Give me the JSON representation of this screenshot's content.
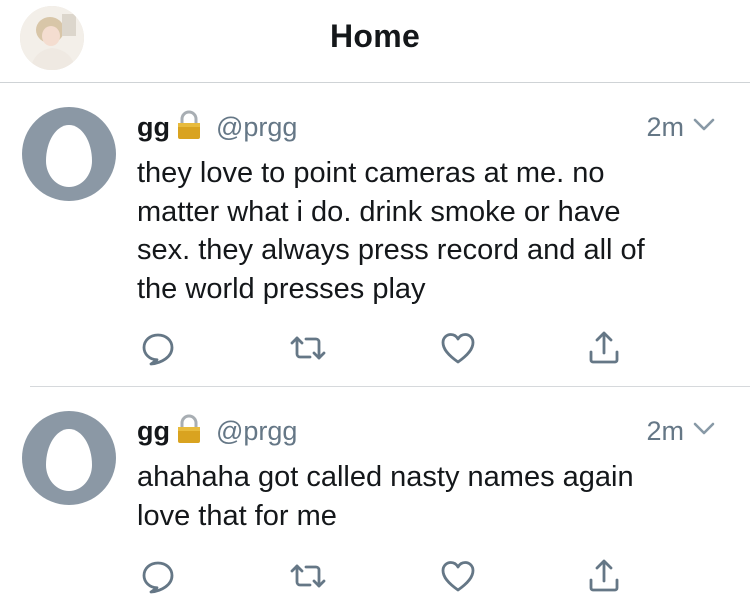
{
  "header": {
    "title": "Home"
  },
  "tweets": [
    {
      "name": "gg",
      "handle": "@prgg",
      "time": "2m",
      "text": "they love to point cameras at me. no\nmatter what i do. drink smoke or have\nsex. they always press record and all of\nthe world presses play"
    },
    {
      "name": "gg",
      "handle": "@prgg",
      "time": "2m",
      "text": "ahahaha got called nasty names again\nlove that for me"
    }
  ],
  "icons": {
    "reply": "reply-icon",
    "retweet": "retweet-icon",
    "like": "heart-icon",
    "share": "share-icon",
    "lock": "lock-icon",
    "caret": "chevron-down-icon"
  },
  "colors": {
    "text": "#14171a",
    "secondary": "#657786",
    "avatar_bg": "#8b98a5",
    "divider": "#cfd3d6"
  }
}
